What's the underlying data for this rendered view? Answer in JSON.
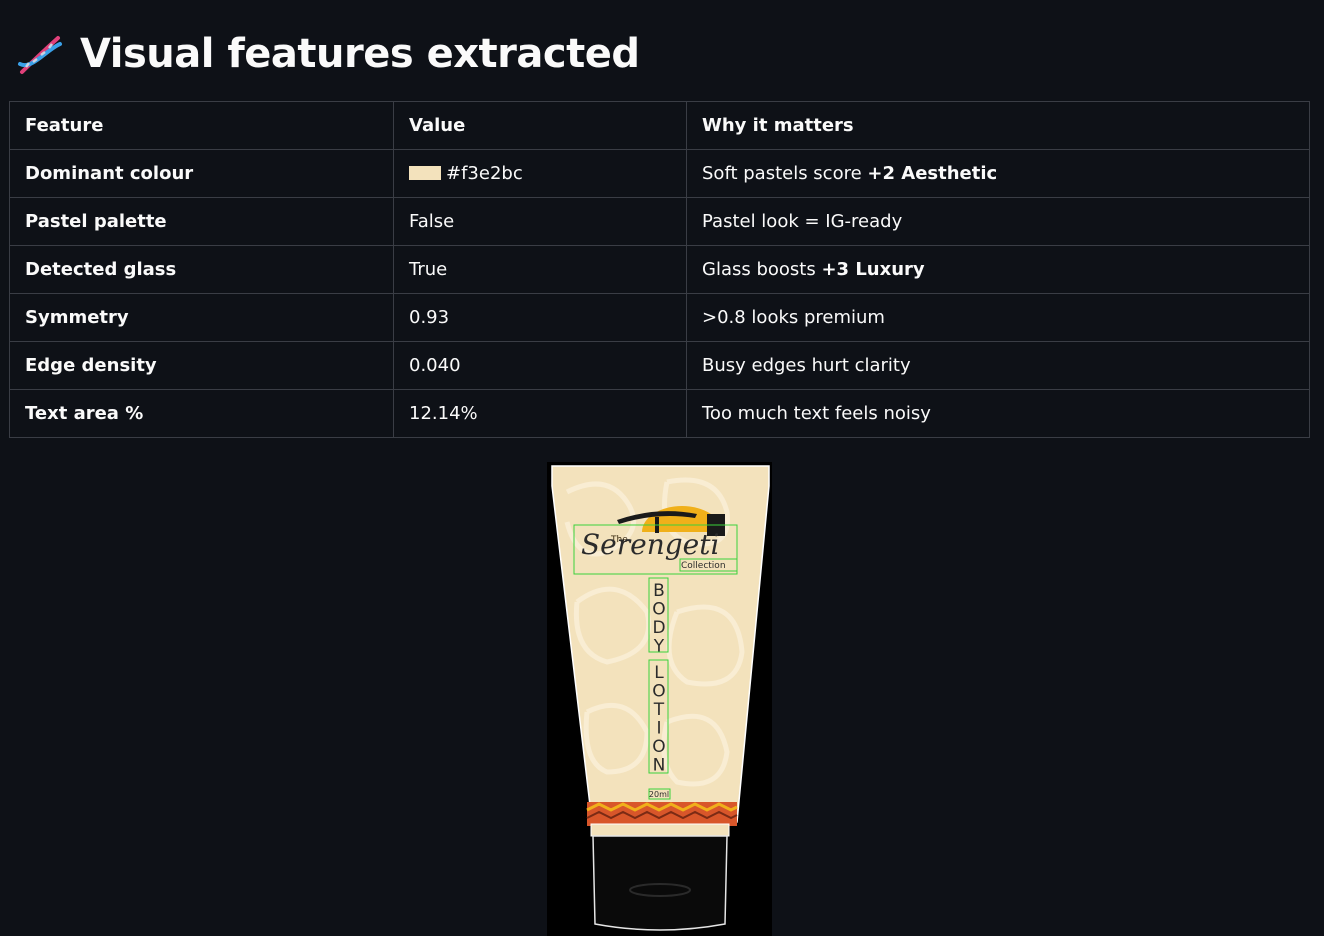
{
  "header": {
    "title": "Visual features extracted",
    "icon": "dna-icon"
  },
  "table": {
    "columns": [
      "Feature",
      "Value",
      "Why it matters"
    ],
    "rows": [
      {
        "feature": "Dominant colour",
        "swatch": "#f3e2bc",
        "value": "#f3e2bc",
        "why": "Soft pastels score ",
        "why_bold": "+2 Aesthetic"
      },
      {
        "feature": "Pastel palette",
        "value": "False",
        "why": "Pastel look = IG-ready",
        "why_bold": ""
      },
      {
        "feature": "Detected glass",
        "value": "True",
        "why": "Glass boosts ",
        "why_bold": "+3 Luxury"
      },
      {
        "feature": "Symmetry",
        "value": "0.93",
        "why": ">0.8 looks premium",
        "why_bold": ""
      },
      {
        "feature": "Edge density",
        "value": "0.040",
        "why": "Busy edges hurt clarity",
        "why_bold": ""
      },
      {
        "feature": "Text area %",
        "value": "12.14%",
        "why": "Too much text feels noisy",
        "why_bold": ""
      }
    ]
  },
  "product_image": {
    "brand_small": "The",
    "brand_script": "Serengeti",
    "brand_sub": "Collection",
    "vertical_word_1": "BODY",
    "vertical_word_2": "LOTION",
    "volume": "20ml",
    "detection_box_color": "#3bd13b",
    "tube_color": "#f3e2bc",
    "cap_color": "#0a0a0a"
  },
  "colors": {
    "background": "#0e1117",
    "border": "#3a3d45",
    "text": "#fafafa"
  }
}
